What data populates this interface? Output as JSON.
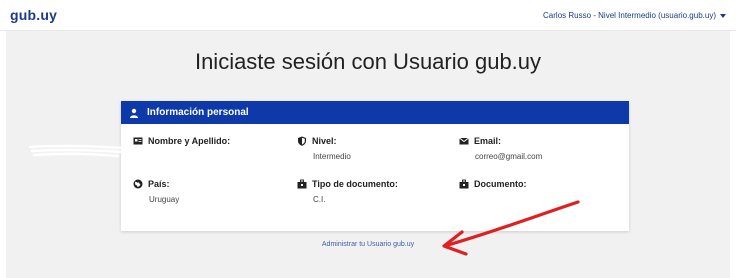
{
  "header": {
    "logo": "gub.uy",
    "user_menu_label": "Carlos Russo - Nivel Intermedio (usuario.gub.uy)"
  },
  "main": {
    "title": "Iniciaste sesión con Usuario gub.uy",
    "card_title": "Información personal",
    "fields": {
      "name": {
        "label": "Nombre y Apellido:",
        "value": ""
      },
      "level": {
        "label": "Nivel:",
        "value": "Intermedio"
      },
      "email": {
        "label": "Email:",
        "value": "correo@gmail.com"
      },
      "country": {
        "label": "País:",
        "value": "Uruguay"
      },
      "doc_type": {
        "label": "Tipo de documento:",
        "value": "C.I."
      },
      "document": {
        "label": "Documento:",
        "value": ""
      }
    },
    "admin_link": "Administrar tu Usuario gub.uy"
  },
  "icons": {
    "card_header": "person-icon",
    "name": "id-card-icon",
    "level": "shield-icon",
    "email": "envelope-icon",
    "country": "globe-icon",
    "doc_type": "briefcase-icon",
    "document": "briefcase-icon"
  },
  "colors": {
    "brand": "#1a3a8a",
    "card_header_bg": "#0d3aa8",
    "page_bg": "#f1f1f1",
    "annotation": "#e02020"
  }
}
